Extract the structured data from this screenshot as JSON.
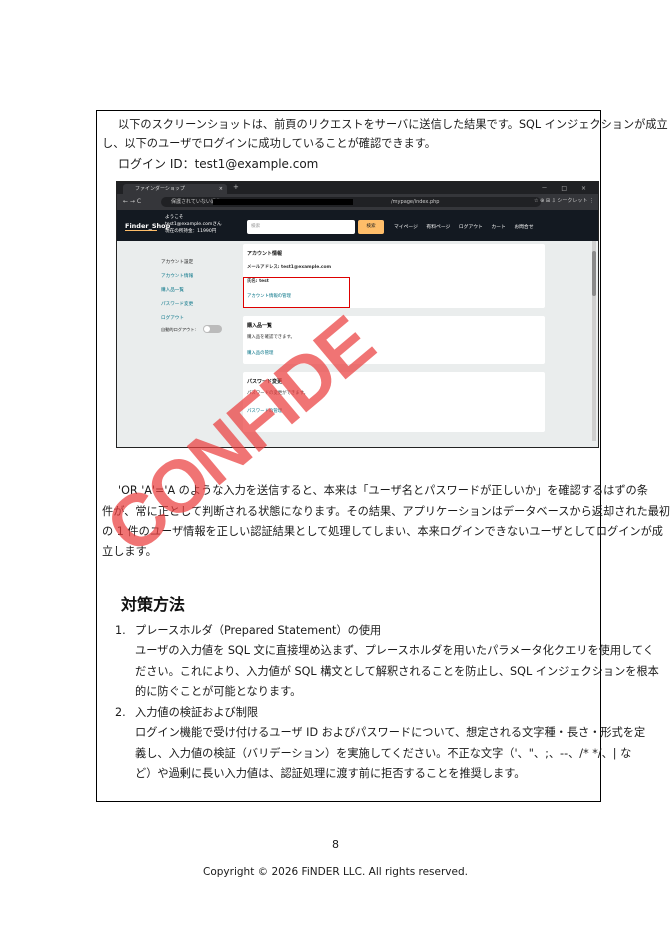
{
  "intro": {
    "line1": "以下のスクリーンショットは、前頁のリクエストをサーバに送信した結果です。SQL インジェクションが成立",
    "line2": "し、以下のユーザでログインに成功していることが確認できます。",
    "login_id": "ログイン ID：test1@example.com"
  },
  "screenshot": {
    "tab_title": "ファインダーショップ",
    "tab_close": "×",
    "new_tab": "+",
    "window_controls": "－ □ ×",
    "nav_buttons": "←  →  C",
    "url_prefix": "保護されていない通信",
    "url_path": "/mypage/index.php",
    "toolbar_icons": "☆   ⊕   ⊞   ⇩   シークレット   ⋮",
    "site": {
      "logo": "Finder_Shop",
      "greeting_line1": "ようこそ",
      "greeting_line2": "test1@example.comさん",
      "greeting_line3": "現在の所持金：11990円",
      "search_placeholder": "検索",
      "search_button": "検索",
      "menu": [
        "マイページ",
        "有料ページ",
        "ログアウト",
        "カート",
        "お問合せ"
      ]
    },
    "sidebar": {
      "heading": "アカウント設定",
      "links": [
        "アカウント情報",
        "購入品一覧",
        "パスワード変更",
        "ログアウト"
      ],
      "auto_logout": "自動的ログアウト:"
    },
    "cards": [
      {
        "title": "アカウント情報",
        "lines": [
          "メールアドレス: test1@example.com",
          "氏名: test"
        ],
        "link": "アカウント情報の管理"
      },
      {
        "title": "購入品一覧",
        "lines": [
          "購入品を確認できます。"
        ],
        "link": "購入品の管理"
      },
      {
        "title": "パスワード変更",
        "lines": [
          "パスワードの変更ができます。"
        ],
        "link": "パスワードの管理"
      }
    ]
  },
  "explanation": [
    "'OR 'A'='A のような入力を送信すると、本来は「ユーザ名とパスワードが正しいか」を確認するはずの条",
    "件が、常に正として判断される状態になります。その結果、アプリケーションはデータベースから返却された最初",
    "の 1 件のユーザ情報を正しい認証結果として処理してしまい、本来ログインできないユーザとしてログインが成",
    "立します。"
  ],
  "countermeasures": {
    "heading": "対策方法",
    "items": [
      {
        "number": "1.",
        "title": "プレースホルダ（Prepared Statement）の使用",
        "body": [
          "ユーザの入力値を SQL 文に直接埋め込まず、プレースホルダを用いたパラメータ化クエリを使用してく",
          "ださい。これにより、入力値が SQL 構文として解釈されることを防止し、SQL インジェクションを根本",
          "的に防ぐことが可能となります。"
        ]
      },
      {
        "number": "2.",
        "title": "入力値の検証および制限",
        "body": [
          "ログイン機能で受け付けるユーザ ID およびパスワードについて、想定される文字種・長さ・形式を定",
          "義し、入力値の検証（バリデーション）を実施してください。不正な文字（'、\"、;、--、/* */、| な",
          "ど）や過剰に長い入力値は、認証処理に渡す前に拒否することを推奨します。"
        ]
      }
    ]
  },
  "watermark": "CONFIDE",
  "page_number": "8",
  "copyright": "Copyright © 2026 FiNDER LLC. All rights reserved.",
  "colors": {
    "watermark": "#ea3e3e",
    "highlight_box": "#dd0000",
    "site_header": "#131921",
    "search_button": "#febd69",
    "link": "#007185"
  }
}
